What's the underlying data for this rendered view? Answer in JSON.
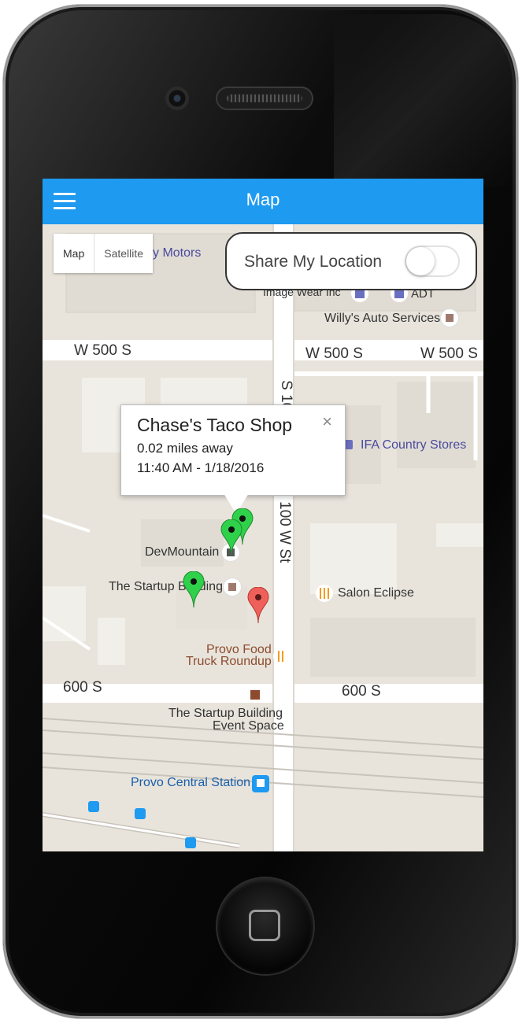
{
  "app": {
    "title": "Map"
  },
  "map_controls": {
    "map_label": "Map",
    "satellite_label": "Satellite"
  },
  "share": {
    "label": "Share My Location",
    "enabled": false
  },
  "popup": {
    "title": "Chase's Taco Shop",
    "distance": "0.02 miles away",
    "time": "11:40 AM - 1/18/2016",
    "close": "×"
  },
  "map_labels": {
    "motors": "y Motors",
    "image_wear": "Image Wear Inc",
    "adt": "ADT",
    "willys": "Willy's Auto Services",
    "w500s_left": "W 500 S",
    "w500s_mid": "W 500 S",
    "w500s_right": "W 500 S",
    "s100": "S 10",
    "ifa": "IFA Country Stores",
    "w100st": "100 W St",
    "devmountain": "DevMountain",
    "startup": "The Startup Building",
    "salon": "Salon Eclipse",
    "food_truck_1": "Provo Food",
    "food_truck_2": "Truck Roundup",
    "s600_left": "600 S",
    "s600_right": "600 S",
    "event_1": "The Startup Building",
    "event_2": "Event Space",
    "station": "Provo Central Station"
  },
  "colors": {
    "appbar": "#1e9af0",
    "pin_green": "#2fd14a",
    "pin_red": "#f0605a"
  }
}
